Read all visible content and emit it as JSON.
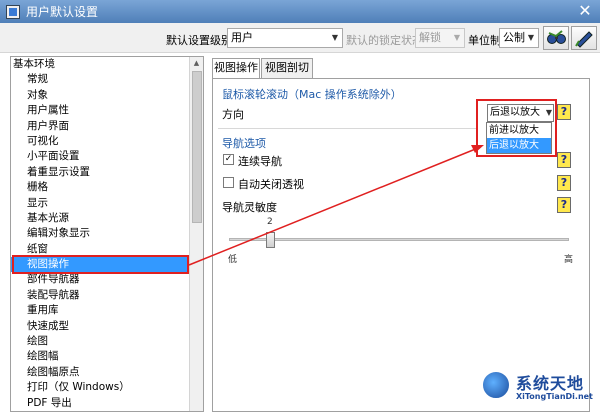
{
  "window": {
    "title": "用户默认设置"
  },
  "toolbar": {
    "level_label": "默认设置级别",
    "level_value": "用户",
    "lock_label": "默认的锁定状态",
    "lock_value": "解锁",
    "unit_label": "单位制",
    "unit_value": "公制"
  },
  "tree": {
    "items": [
      {
        "label": "基本环境",
        "root": true
      },
      {
        "label": "常规"
      },
      {
        "label": "对象"
      },
      {
        "label": "用户属性"
      },
      {
        "label": "用户界面"
      },
      {
        "label": "可视化"
      },
      {
        "label": "小平面设置"
      },
      {
        "label": "着重显示设置"
      },
      {
        "label": "栅格"
      },
      {
        "label": "显示"
      },
      {
        "label": "基本光源"
      },
      {
        "label": "编辑对象显示"
      },
      {
        "label": "纸窗"
      },
      {
        "label": "视图操作",
        "selected": true
      },
      {
        "label": "部件导航器"
      },
      {
        "label": "装配导航器"
      },
      {
        "label": "重用库"
      },
      {
        "label": "快速成型"
      },
      {
        "label": "绘图"
      },
      {
        "label": "绘图幅"
      },
      {
        "label": "绘图幅原点"
      },
      {
        "label": "打印（仅 Windows）"
      },
      {
        "label": "PDF 导出"
      }
    ]
  },
  "tabs": [
    {
      "label": "视图操作",
      "active": true
    },
    {
      "label": "视图剖切",
      "active": false
    }
  ],
  "scroll_section": {
    "title": "鼠标滚轮滚动（Mac 操作系统除外）",
    "direction_label": "方向",
    "direction_value": "后退以放大",
    "options": [
      "前进以放大",
      "后退以放大"
    ],
    "highlighted_option": "后退以放大"
  },
  "nav_section": {
    "title": "导航选项",
    "continuous_label": "连续导航",
    "continuous_checked": true,
    "auto_close_label": "自动关闭透视",
    "auto_close_checked": false,
    "sensitivity_label": "导航灵敏度",
    "sensitivity_value": "2",
    "low_label": "低",
    "high_label": "高"
  },
  "help_glyph": "?",
  "watermark": {
    "title": "系统天地",
    "url": "XiTongTianDi.net"
  },
  "colors": {
    "annotation_red": "#e02020",
    "selection_blue": "#3399ff",
    "section_blue": "#1e5aa8"
  }
}
